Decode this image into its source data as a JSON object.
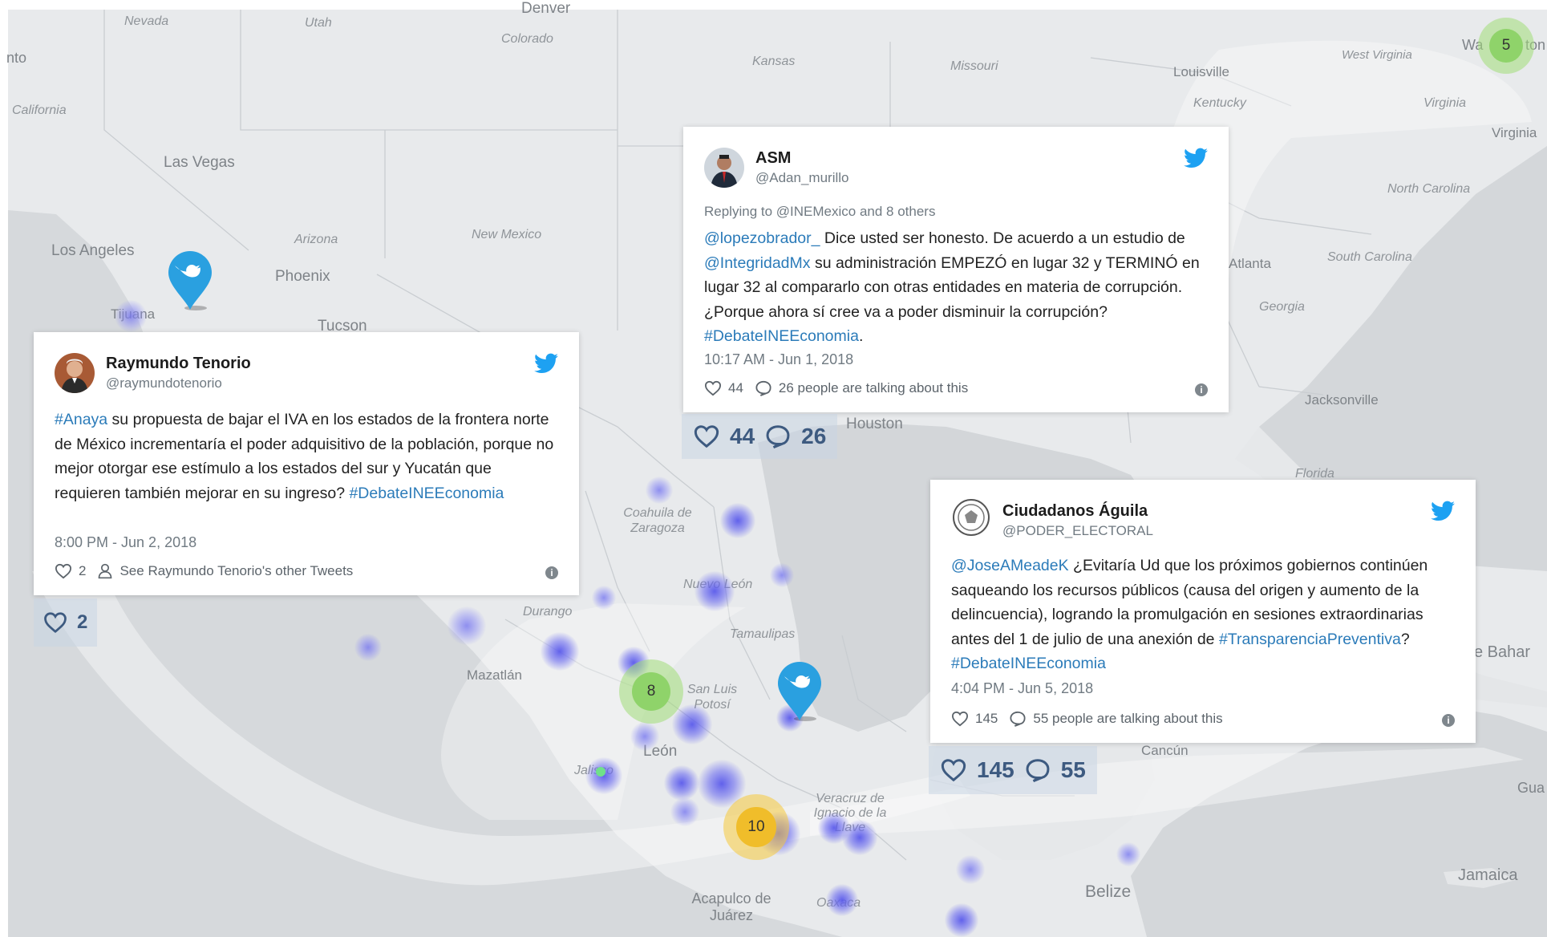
{
  "map": {
    "state_labels": [
      {
        "text": "Nevada",
        "key": "nv"
      },
      {
        "text": "Utah",
        "key": "ut"
      },
      {
        "text": "Colorado",
        "key": "co"
      },
      {
        "text": "Kansas",
        "key": "ks"
      },
      {
        "text": "Missouri",
        "key": "mo"
      },
      {
        "text": "West Virginia",
        "key": "wv"
      },
      {
        "text": "California",
        "key": "ca"
      },
      {
        "text": "Kentucky",
        "key": "ky"
      },
      {
        "text": "Virginia",
        "key": "va"
      },
      {
        "text": "North Carolina",
        "key": "nc"
      },
      {
        "text": "South Carolina",
        "key": "sc"
      },
      {
        "text": "Arizona",
        "key": "az"
      },
      {
        "text": "New Mexico",
        "key": "nm"
      },
      {
        "text": "Georgia",
        "key": "ga"
      },
      {
        "text": "Florida",
        "key": "fl"
      },
      {
        "text": "Coahuila de Zaragoza",
        "key": "coah"
      },
      {
        "text": "Durango",
        "key": "dgo"
      },
      {
        "text": "Nuevo León",
        "key": "nl"
      },
      {
        "text": "Tamaulipas",
        "key": "tamps"
      },
      {
        "text": "San Luis Potosí",
        "key": "slp"
      },
      {
        "text": "Jalisco",
        "key": "jal"
      },
      {
        "text": "Veracruz de Ignacio de la Llave",
        "key": "ver"
      },
      {
        "text": "Oaxaca",
        "key": "oax"
      }
    ],
    "city_labels": [
      {
        "text": "Denver",
        "key": "den"
      },
      {
        "text": "Louisville",
        "key": "lou"
      },
      {
        "text": "Virginia",
        "key": "va2"
      },
      {
        "text": "Las Vegas",
        "key": "lv"
      },
      {
        "text": "Los Angeles",
        "key": "la"
      },
      {
        "text": "Phoenix",
        "key": "phx"
      },
      {
        "text": "Tijuana",
        "key": "tij"
      },
      {
        "text": "Tucson",
        "key": "tuc"
      },
      {
        "text": "Atlanta",
        "key": "atl"
      },
      {
        "text": "Jacksonville",
        "key": "jax"
      },
      {
        "text": "Houston",
        "key": "hou"
      },
      {
        "text": "Mazatlán",
        "key": "maz"
      },
      {
        "text": "León",
        "key": "leon"
      },
      {
        "text": "Cancún",
        "key": "cun"
      },
      {
        "text": "Acapulco de Juárez",
        "key": "aca"
      },
      {
        "text": "Belize",
        "key": "bze"
      },
      {
        "text": "Jamaica",
        "key": "jam"
      },
      {
        "text": "Gua",
        "key": "gua"
      },
      {
        "text": "e Bahar",
        "key": "bah"
      },
      {
        "text": "nto",
        "key": "nto"
      },
      {
        "text": "Wa",
        "key": "wa"
      },
      {
        "text": "ton",
        "key": "ton"
      }
    ],
    "clusters": [
      {
        "count": "5",
        "color": "green"
      },
      {
        "count": "8",
        "color": "green"
      },
      {
        "count": "10",
        "color": "yellow"
      }
    ],
    "pin_icon": "twitter-bird-icon",
    "accent_color": "#1da1f2",
    "link_color": "#2b7bb9"
  },
  "tweets": [
    {
      "id": "asm",
      "name": "ASM",
      "handle": "@Adan_murillo",
      "reply": "Replying to @INEMexico and 8 others",
      "body_parts": [
        {
          "t": "@lopezobrador_",
          "link": true
        },
        {
          "t": " Dice usted ser honesto. De acuerdo a un estudio de ",
          "link": false
        },
        {
          "t": "@IntegridadMx",
          "link": true
        },
        {
          "t": " su administración EMPEZÓ en lugar 32 y TERMINÓ en lugar 32 al compararlo con otras entidades en materia de corrupción. ¿Porque ahora sí cree va a poder disminuir la corrupción? ",
          "link": false
        },
        {
          "t": "#DebateINEEconomia",
          "link": true
        },
        {
          "t": ".",
          "link": false
        }
      ],
      "time": "10:17 AM - Jun 1, 2018",
      "likes": "44",
      "talk": "26 people are talking about this",
      "stat_likes": "44",
      "stat_comments": "26"
    },
    {
      "id": "raymundo",
      "name": "Raymundo Tenorio",
      "handle": "@raymundotenorio",
      "body_parts": [
        {
          "t": "#Anaya",
          "link": true
        },
        {
          "t": " su propuesta de bajar el IVA en los estados de la frontera norte de México incrementaría el poder adquisitivo de la población, porque no mejor otorgar ese estímulo a los estados del sur y Yucatán que requieren también mejorar en su ingreso? ",
          "link": false
        },
        {
          "t": "#DebateINEEconomia",
          "link": true
        }
      ],
      "time": "8:00 PM - Jun 2, 2018",
      "likes": "2",
      "talk": "See Raymundo Tenorio's other Tweets",
      "stat_likes": "2"
    },
    {
      "id": "aguila",
      "name": "Ciudadanos Águila",
      "handle": "@PODER_ELECTORAL",
      "body_parts": [
        {
          "t": "@JoseAMeadeK",
          "link": true
        },
        {
          "t": " ¿Evitaría Ud que los próximos gobiernos continúen saqueando los recursos públicos (causa del origen y aumento de la delincuencia), logrando la promulgación en sesiones extraordinarias antes del 1 de julio de una anexión de ",
          "link": false
        },
        {
          "t": "#TransparenciaPreventiva",
          "link": true
        },
        {
          "t": "?",
          "link": false
        },
        {
          "t": "#DebateINEEconomia",
          "link": true
        }
      ],
      "time": "4:04 PM - Jun 5, 2018",
      "likes": "145",
      "talk": "55 people are talking about this",
      "stat_likes": "145",
      "stat_comments": "55"
    }
  ]
}
